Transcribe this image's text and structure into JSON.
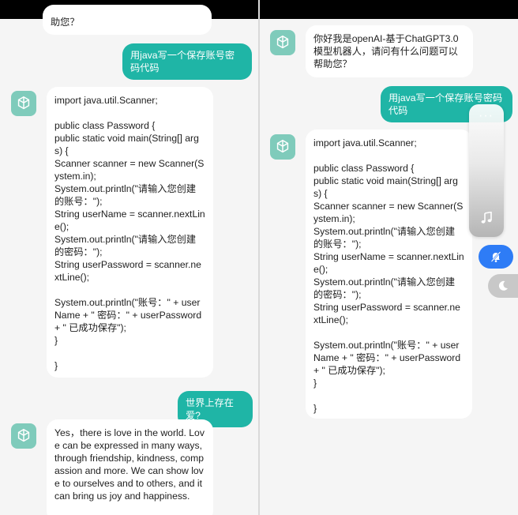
{
  "left": {
    "top_cut_text": "助您？",
    "user_msg_1": "用java写一个保存账号密码代码",
    "bot_code_lines": [
      "import java.util.Scanner;",
      "",
      "public class Password {",
      "public static void main(String[] args) {",
      "Scanner scanner = new Scanner(System.in);",
      "System.out.println(\"请输入您创建的账号：\");",
      "String userName = scanner.nextLine();",
      "System.out.println(\"请输入您创建的密码：\");",
      "String userPassword = scanner.nextLine();",
      "",
      "System.out.println(\"账号：\" + userName + \" 密码：\" + userPassword + \" 已成功保存\");",
      "}",
      "",
      "}"
    ],
    "user_msg_2": "世界上存在爱?",
    "bot_reply_2": "Yes，there is love in the world. Love can be expressed in many ways, through friendship, kindness, compassion and more. We can show love to ourselves and to others, and it can bring us joy and happiness."
  },
  "right": {
    "bot_greeting": "你好我是openAI-基于ChatGPT3.0模型机器人，请问有什么问题可以帮助您？",
    "user_msg_1": "用java写一个保存账号密码代码",
    "bot_code_lines": [
      "import java.util.Scanner;",
      "",
      "public class Password {",
      "public static void main(String[] args) {",
      "Scanner scanner = new Scanner(System.in);",
      "System.out.println(\"请输入您创建的账号：\");",
      "String userName = scanner.nextLine();",
      "System.out.println(\"请输入您创建的密码：\");",
      "String userPassword = scanner.nextLine();",
      "",
      "System.out.println(\"账号：\" + userName + \" 密码：\" + userPassword + \" 已成功保存\");",
      "}",
      "",
      "}"
    ]
  },
  "float": {
    "dots": "···"
  },
  "icons": [
    "openai-logo-icon",
    "music-note-icon",
    "bell-off-icon",
    "moon-icon"
  ],
  "colors": {
    "user_bubble": "#1fb5a6",
    "avatar": "#7fcbbb",
    "blue_button": "#2e7cf6"
  }
}
